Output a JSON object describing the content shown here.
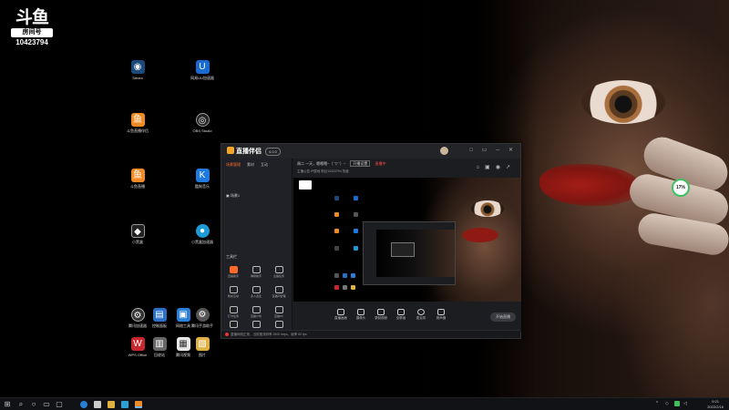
{
  "watermark": {
    "logo": "斗鱼",
    "room_label": "房间号",
    "room_number": "10423794"
  },
  "desktop_icons": [
    {
      "label": "Steam",
      "color": "#1b4a7a",
      "glyph": "◉"
    },
    {
      "label": "网易UU加速器",
      "color": "#1a6bd1",
      "glyph": "U"
    },
    {
      "label": "斗鱼直播伴侣",
      "color": "#f08a24",
      "glyph": "鱼"
    },
    {
      "label": "OBS Studio",
      "color": "#222222",
      "glyph": "◎"
    },
    {
      "label": "斗鱼直播",
      "color": "#f08a24",
      "glyph": "鱼"
    },
    {
      "label": "酷狗音乐",
      "color": "#1f7ae0",
      "glyph": "K"
    },
    {
      "label": "小黑盒",
      "color": "#222222",
      "glyph": "◆"
    },
    {
      "label": "小黑盒加速器",
      "color": "#1c9ad6",
      "glyph": "●"
    },
    {
      "label": "腾讯加速器",
      "color": "#333333",
      "glyph": "⚙"
    },
    {
      "label": "控制面板",
      "color": "#2a6fc9",
      "glyph": "▤"
    },
    {
      "label": "网络工具",
      "color": "#2a7fd6",
      "glyph": "▣"
    },
    {
      "label": "腾讯手游助手",
      "color": "#555555",
      "glyph": "⚙"
    },
    {
      "label": "WPS Office",
      "color": "#c8282d",
      "glyph": "W"
    },
    {
      "label": "回收站",
      "color": "#666666",
      "glyph": "▥"
    },
    {
      "label": "腾讯视频",
      "color": "#e8e8e8",
      "glyph": "▦"
    },
    {
      "label": "图片",
      "color": "#e0b040",
      "glyph": "▧"
    }
  ],
  "app": {
    "brand": "直播伴侣",
    "version": "4.0.0",
    "window_buttons": "□ ▭ ─ ✕",
    "sidebar": {
      "tabs": [
        "场景管理",
        "素材",
        "互动"
      ],
      "scene_name": "场景1",
      "tools_title": "工具栏",
      "tools": [
        "直播助手",
        "弹幕助手",
        "主播任务",
        "粉丝互动",
        "多人连麦",
        "直播间管理",
        "打卡任务",
        "直播计时",
        "直播PK",
        "活动中心",
        "更多工具",
        "设置"
      ]
    },
    "header": {
      "title": "周二 一天，嗯嗯嗯~（¯▽¯）~",
      "live_badge": "直播中",
      "status_tag": "开播设置",
      "sub_info": "主播公告   IP属地   粉丝10423794   热度"
    },
    "controls": [
      "直播画面",
      "摄像头",
      "录制视频",
      "全屏画",
      "麦克风",
      "扬声器"
    ],
    "start_label": "开始直播",
    "status_bar": "直播网络正常，当前推流码率 2500 kbps，帧率 60 fps"
  },
  "progress_bubble": "17%",
  "taskbar": {
    "search_glyph": "⌕",
    "time": "9:21",
    "date": "2022/2/16"
  }
}
